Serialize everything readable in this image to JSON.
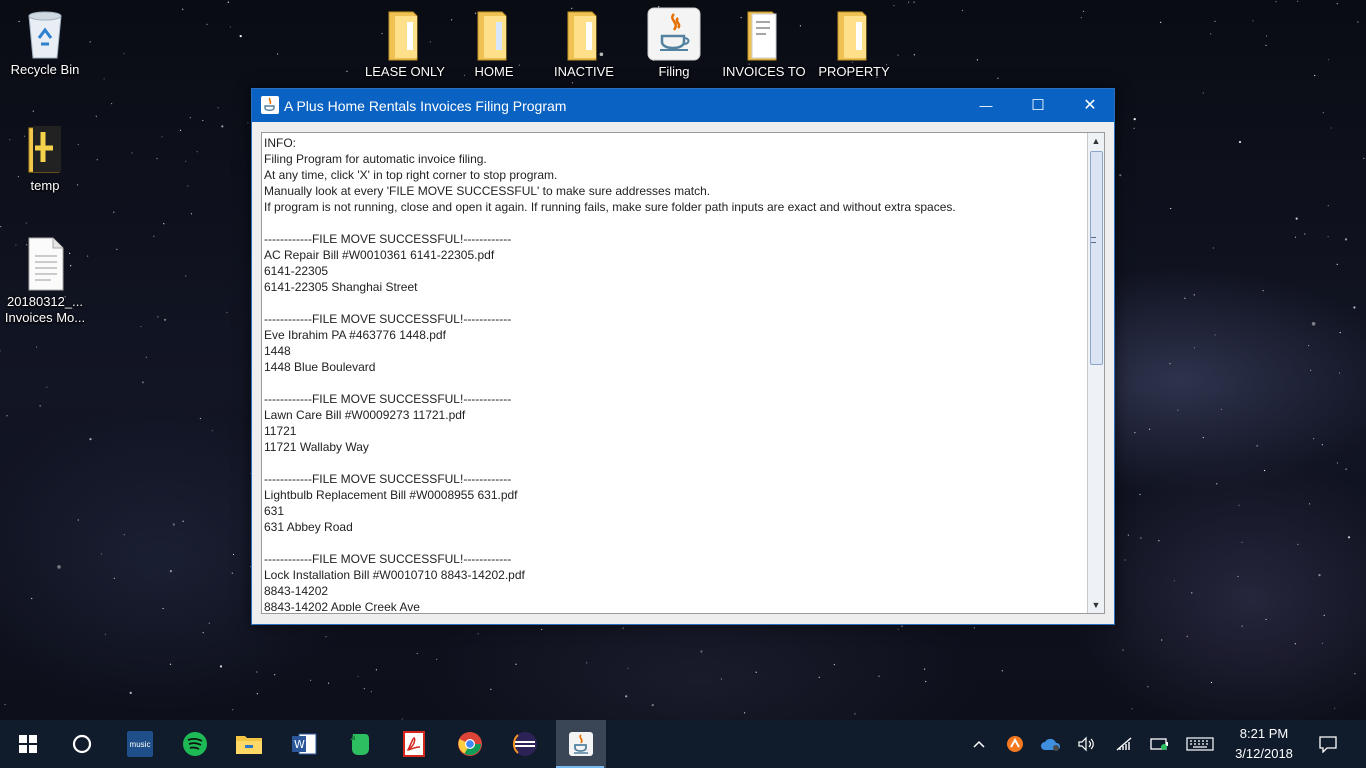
{
  "desktop": {
    "left_icons": [
      {
        "label": "Recycle Bin"
      },
      {
        "label": "temp"
      },
      {
        "label_line1": "20180312_...",
        "label_line2": "Invoices Mo..."
      }
    ],
    "top_icons": [
      {
        "label": "LEASE ONLY",
        "icon": "folder-icon"
      },
      {
        "label": "HOME",
        "icon": "folder-icon"
      },
      {
        "label": "INACTIVE",
        "icon": "folder-icon"
      },
      {
        "label": "Filing",
        "icon": "java-icon"
      },
      {
        "label": "INVOICES TO",
        "icon": "folder-icon"
      },
      {
        "label": "PROPERTY",
        "icon": "folder-icon"
      }
    ]
  },
  "window": {
    "title": "A Plus Home Rentals Invoices Filing Program",
    "controls": {
      "minimize": "—",
      "maximize": "☐",
      "close": "✕"
    },
    "log_text": "INFO:\nFiling Program for automatic invoice filing.\nAt any time, click 'X' in top right corner to stop program.\nManually look at every 'FILE MOVE SUCCESSFUL' to make sure addresses match.\nIf program is not running, close and open it again. If running fails, make sure folder path inputs are exact and without extra spaces.\n\n------------FILE MOVE SUCCESSFUL!------------\nAC Repair Bill #W0010361 6141-22305.pdf\n6141-22305\n6141-22305 Shanghai Street\n\n------------FILE MOVE SUCCESSFUL!------------\nEve Ibrahim PA #463776 1448.pdf\n1448\n1448 Blue Boulevard\n\n------------FILE MOVE SUCCESSFUL!------------\nLawn Care Bill #W0009273 11721.pdf\n11721\n11721 Wallaby Way\n\n------------FILE MOVE SUCCESSFUL!------------\nLightbulb Replacement Bill #W0008955 631.pdf\n631\n631 Abbey Road\n\n------------FILE MOVE SUCCESSFUL!------------\nLock Installation Bill #W0010710 8843-14202.pdf\n8843-14202\n8843-14202 Apple Creek Ave"
  },
  "taskbar": {
    "apps": [
      "windows-start",
      "cortana",
      "amazon-music",
      "spotify",
      "file-explorer",
      "word",
      "evernote",
      "acrobat",
      "chrome",
      "eclipse",
      "java-filing"
    ],
    "music_label": "music",
    "clock": {
      "time": "8:21 PM",
      "date": "3/12/2018"
    }
  },
  "colors": {
    "titlebar": "#0a62c2",
    "taskbar": "#101b2c",
    "accent": "#76b9ed"
  }
}
